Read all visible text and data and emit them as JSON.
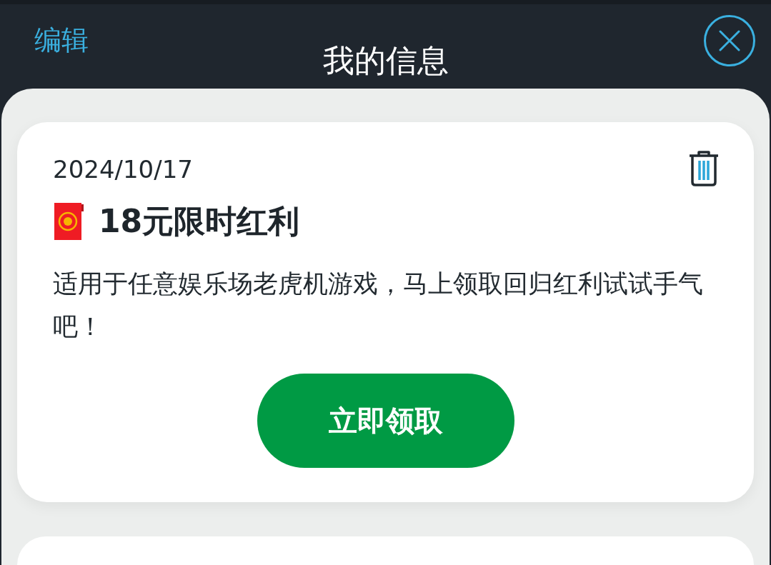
{
  "header": {
    "edit_label": "编辑",
    "title": "我的信息"
  },
  "messages": [
    {
      "date": "2024/10/17",
      "title": "18元限时红利",
      "body": "适用于任意娱乐场老虎机游戏，马上领取回归红利试试手气吧！",
      "action": "立即领取"
    }
  ]
}
